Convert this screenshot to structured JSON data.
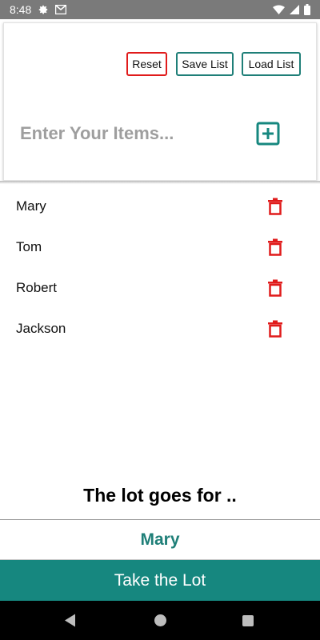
{
  "status_bar": {
    "time": "8:48",
    "icons": [
      "gear-icon",
      "gmail-icon",
      "wifi-icon",
      "signal-icon",
      "battery-icon"
    ]
  },
  "header": {
    "reset_label": "Reset",
    "save_label": "Save List",
    "load_label": "Load List",
    "input_placeholder": "Enter Your Items...",
    "input_value": "",
    "add_icon": "plus-square-icon"
  },
  "items": [
    {
      "name": "Mary",
      "action_icon": "trash-icon"
    },
    {
      "name": "Tom",
      "action_icon": "trash-icon"
    },
    {
      "name": "Robert",
      "action_icon": "trash-icon"
    },
    {
      "name": "Jackson",
      "action_icon": "trash-icon"
    }
  ],
  "result": {
    "label": "The lot goes for ..",
    "winner": "Mary",
    "action_label": "Take the Lot"
  },
  "nav": {
    "icons": [
      "back-icon",
      "home-icon",
      "recents-icon"
    ]
  },
  "colors": {
    "accent": "#16877f",
    "danger": "#e01b1b",
    "status_bar": "#7a7a7a",
    "placeholder": "#9e9e9e"
  }
}
